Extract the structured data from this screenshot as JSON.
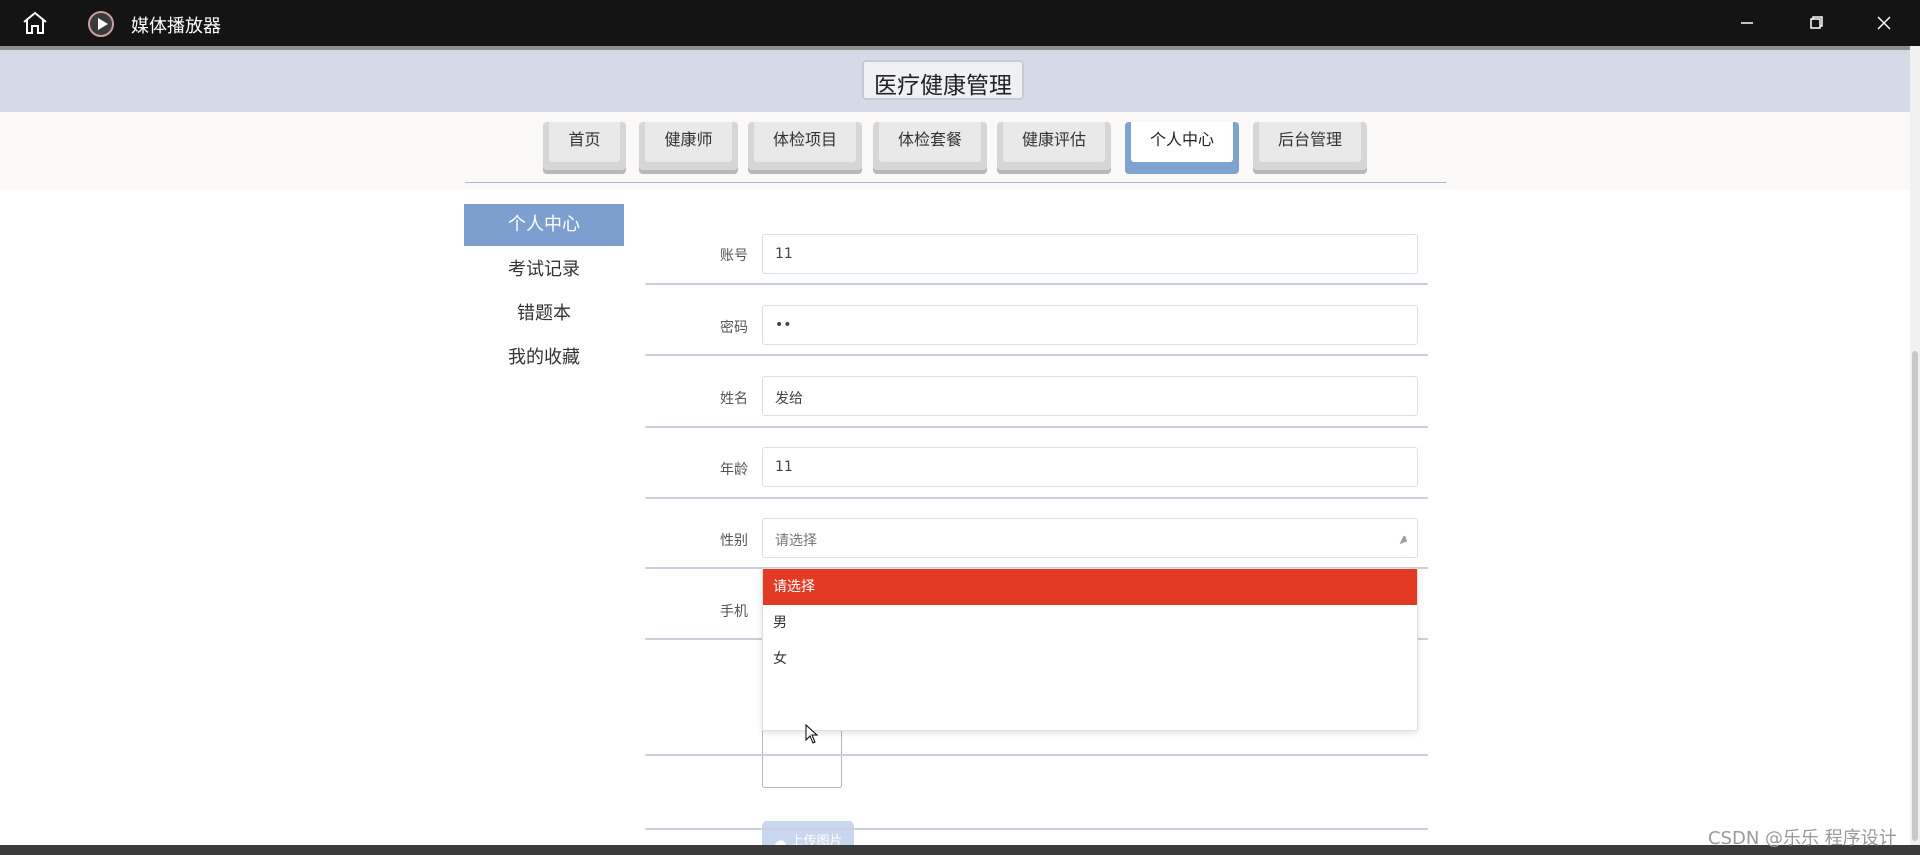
{
  "window": {
    "app_title": "媒体播放器",
    "home_icon": "home-icon",
    "app_icon": "media-player-icon",
    "minimize_icon": "minimize-icon",
    "maximize_icon": "restore-icon",
    "close_icon": "close-icon"
  },
  "site": {
    "title": "医疗健康管理"
  },
  "nav": {
    "tabs": [
      {
        "label": "首页"
      },
      {
        "label": "健康师"
      },
      {
        "label": "体检项目"
      },
      {
        "label": "体检套餐"
      },
      {
        "label": "健康评估"
      },
      {
        "label": "个人中心"
      },
      {
        "label": "后台管理"
      }
    ],
    "active_tab": "个人中心"
  },
  "side_menu": {
    "items": [
      {
        "label": "个人中心"
      },
      {
        "label": "考试记录"
      },
      {
        "label": "错题本"
      },
      {
        "label": "我的收藏"
      }
    ],
    "active_item": "个人中心"
  },
  "form": {
    "account": {
      "label": "账号",
      "value": "11"
    },
    "password": {
      "label": "密码",
      "value": "••"
    },
    "name": {
      "label": "姓名",
      "value": "发给"
    },
    "age": {
      "label": "年龄",
      "value": "11"
    },
    "gender": {
      "label": "性别",
      "placeholder": "请选择",
      "options": [
        "请选择",
        "男",
        "女"
      ],
      "highlighted": "请选择"
    },
    "phone": {
      "label": "手机"
    },
    "upload_label": "上传图片"
  },
  "colors": {
    "active_tab": "#7fa2d1",
    "side_active": "#7c9fcf",
    "dropdown_highlight": "#e33a25",
    "upload_button": "#c8d7ee"
  },
  "watermark": "CSDN @乐乐 程序设计"
}
